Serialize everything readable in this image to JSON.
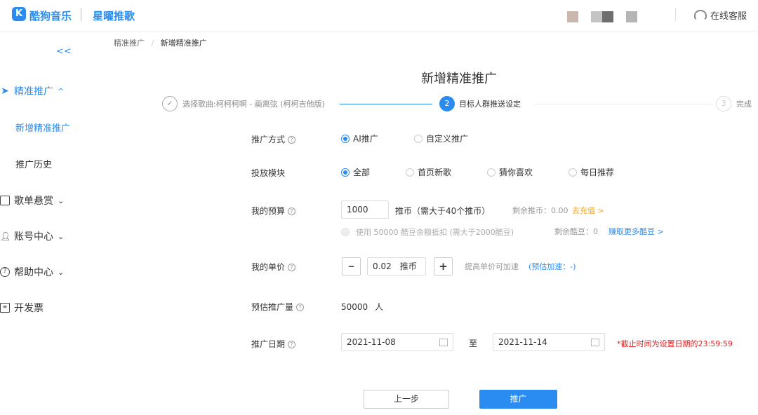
{
  "header": {
    "logo_icon": "K",
    "brand": "酷狗音乐",
    "product": "星曜推歌",
    "support": "在线客服"
  },
  "breadcrumb": {
    "parent": "精准推广",
    "current": "新增精准推广"
  },
  "sidebar": {
    "collapse": "<<",
    "items": [
      {
        "label": "精准推广",
        "icon": "send-icon",
        "chevron": "^"
      },
      {
        "label": "新增精准推广"
      },
      {
        "label": "推广历史"
      },
      {
        "label": "歌单悬赏",
        "icon": "clipboard-icon",
        "chevron": "⌄"
      },
      {
        "label": "账号中心",
        "icon": "user-icon",
        "chevron": "⌄"
      },
      {
        "label": "帮助中心",
        "icon": "help-icon",
        "chevron": "⌄"
      },
      {
        "label": "开发票",
        "icon": "invoice-icon"
      }
    ]
  },
  "page": {
    "title": "新增精准推广"
  },
  "steps": [
    {
      "label": "选择歌曲:柯柯柯啊 - 画离弦 (柯柯吉他版)",
      "num": "✓"
    },
    {
      "label": "目标人群推送设定",
      "num": "2"
    },
    {
      "label": "完成",
      "num": "3"
    }
  ],
  "form": {
    "mode": {
      "label": "推广方式",
      "options": [
        "AI推广",
        "自定义推广"
      ],
      "selected": 0
    },
    "module": {
      "label": "投放模块",
      "options": [
        "全部",
        "首页新歌",
        "猜你喜欢",
        "每日推荐"
      ],
      "selected": 0
    },
    "budget": {
      "label": "我的预算",
      "value": "1000",
      "unit": "推币（需大于40个推币）",
      "balance": "剩余推币：0.00",
      "recharge": "去充值 >",
      "beans_option": "使用 50000 酷豆余额抵扣 (需大于2000酷豆)",
      "beans_balance": "剩余酷豆：0",
      "earn_beans": "赚取更多酷豆 >"
    },
    "price": {
      "label": "我的单价",
      "value": "0.02",
      "unit": "推币",
      "minus": "−",
      "plus": "+",
      "hint": "提高单价可加速",
      "speedup": "(预估加速：-)"
    },
    "estimate": {
      "label": "预估推广量",
      "value": "50000",
      "unit": "人"
    },
    "date": {
      "label": "推广日期",
      "start": "2021-11-08",
      "to": "至",
      "end": "2021-11-14",
      "note": "*截止时间为设置日期的23:59:59"
    }
  },
  "buttons": {
    "prev": "上一步",
    "submit": "推广"
  },
  "colors": {
    "accent": "#2a8cf0",
    "warning": "#f5a623",
    "error": "#e02020"
  }
}
